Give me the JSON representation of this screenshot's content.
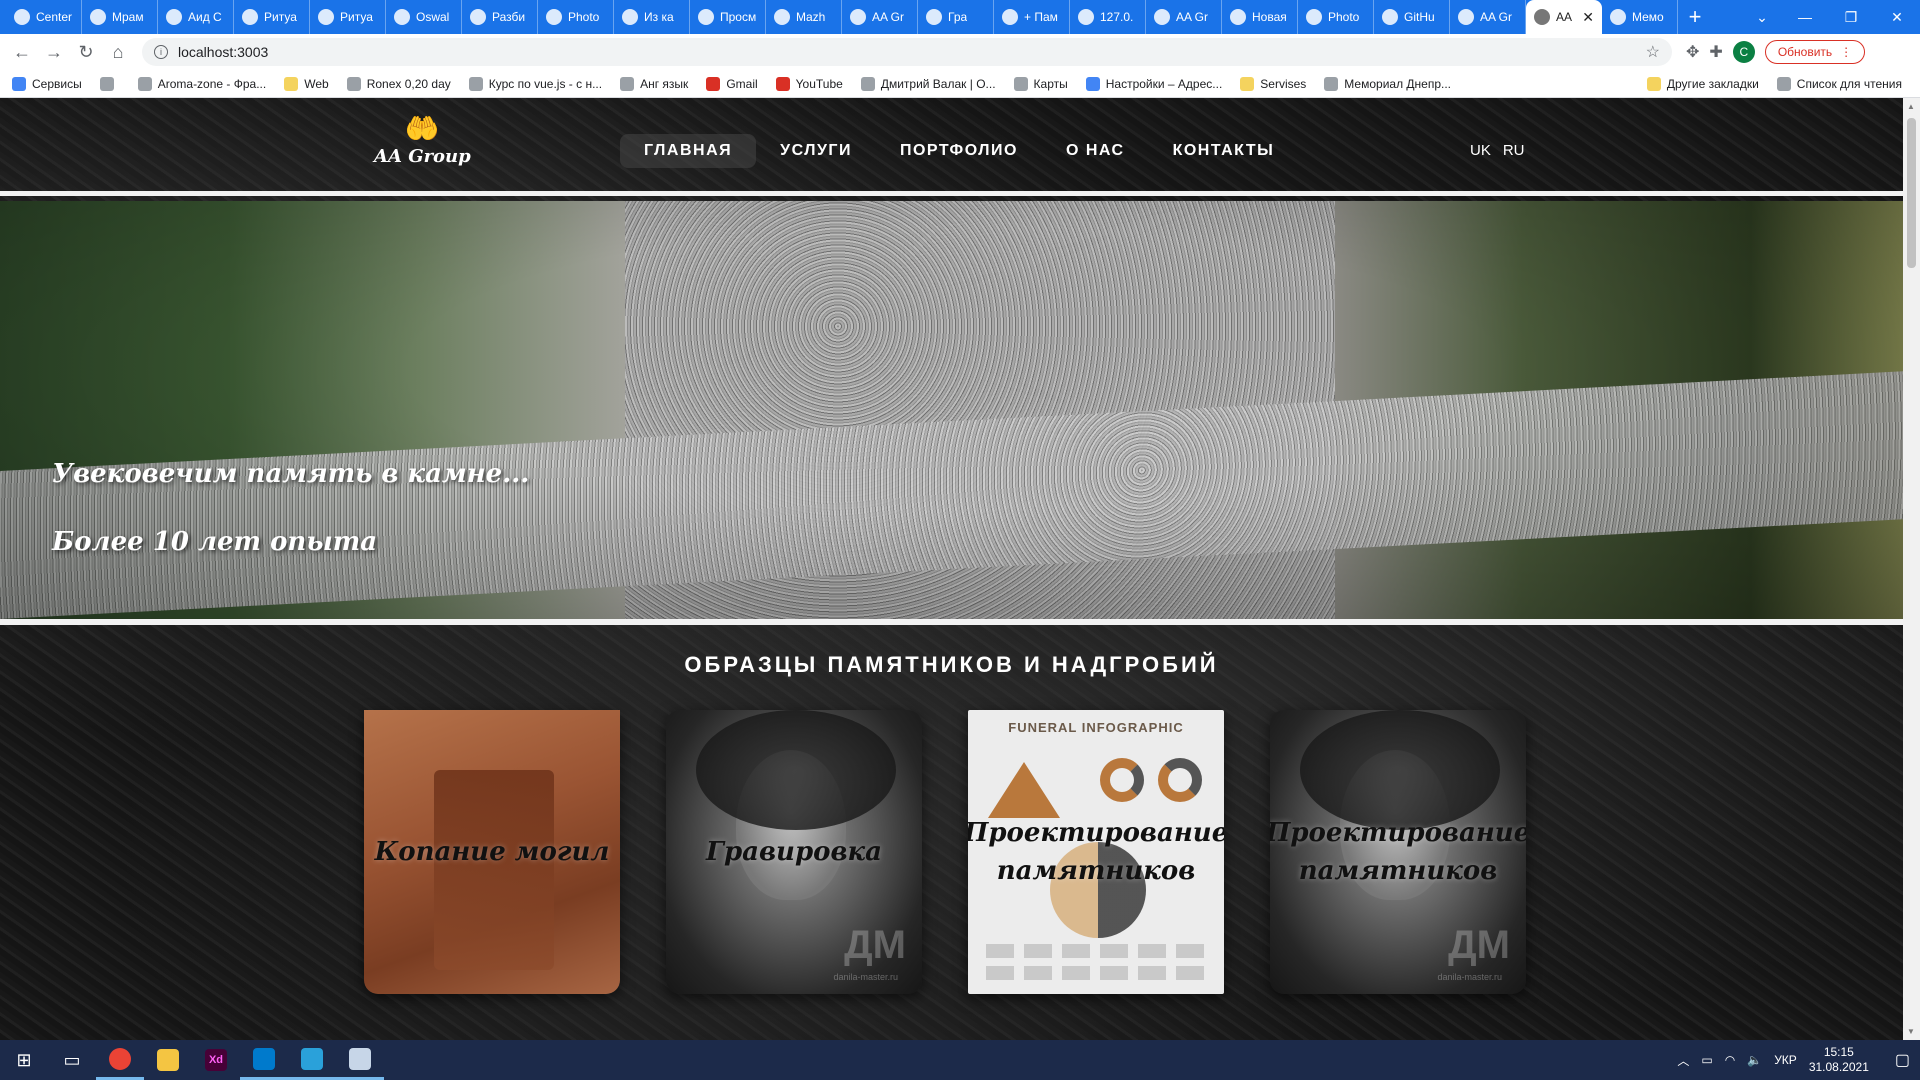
{
  "browser": {
    "tabs": [
      {
        "title": "Center"
      },
      {
        "title": "Мрам"
      },
      {
        "title": "Аид С"
      },
      {
        "title": "Ритуа"
      },
      {
        "title": "Ритуа"
      },
      {
        "title": "Oswal"
      },
      {
        "title": "Разби"
      },
      {
        "title": "Photo"
      },
      {
        "title": "Из ка"
      },
      {
        "title": "Просм"
      },
      {
        "title": "Mazh"
      },
      {
        "title": "AA Gr"
      },
      {
        "title": "Гра"
      },
      {
        "title": "+ Пам"
      },
      {
        "title": "127.0."
      },
      {
        "title": "AA Gr"
      },
      {
        "title": "Новая"
      },
      {
        "title": "Photo"
      },
      {
        "title": "GitHu"
      },
      {
        "title": "AA Gr"
      },
      {
        "title": "AA",
        "active": true
      },
      {
        "title": "Мемо"
      }
    ],
    "new_tab_label": "+",
    "url": "localhost:3003",
    "update_label": "Обновить",
    "profile_initial": "С",
    "bookmarks": [
      {
        "label": "Сервисы",
        "icon": "grid"
      },
      {
        "label": "",
        "icon": "globe"
      },
      {
        "label": "Aroma-zone - Фра...",
        "icon": "site"
      },
      {
        "label": "Web",
        "icon": "folder"
      },
      {
        "label": "Ronex 0,20 day",
        "icon": "site"
      },
      {
        "label": "Курс по vue.js - с н...",
        "icon": "site"
      },
      {
        "label": "Анг язык",
        "icon": "site"
      },
      {
        "label": "Gmail",
        "icon": "red"
      },
      {
        "label": "YouTube",
        "icon": "red"
      },
      {
        "label": "Дмитрий Валак | О...",
        "icon": "site"
      },
      {
        "label": "Карты",
        "icon": "site"
      },
      {
        "label": "Настройки – Адрес...",
        "icon": "grid"
      },
      {
        "label": "Servises",
        "icon": "folder"
      },
      {
        "label": "Мемориал Днепр...",
        "icon": "site"
      }
    ],
    "bookmarks_right": [
      {
        "label": "Другие закладки",
        "icon": "folder"
      },
      {
        "label": "Список для чтения",
        "icon": "site"
      }
    ]
  },
  "site": {
    "logo_text": "AA Group",
    "nav": [
      {
        "label": "ГЛАВНАЯ",
        "active": true
      },
      {
        "label": "УСЛУГИ"
      },
      {
        "label": "ПОРТФОЛИО"
      },
      {
        "label": "О НАС"
      },
      {
        "label": "КОНТАКТЫ"
      }
    ],
    "languages": [
      "UK",
      "RU"
    ],
    "hero": {
      "line1": "Увековечим память в камне...",
      "line2": "Более 10 лет опыта"
    },
    "section_title": "ОБРАЗЦЫ ПАМЯТНИКОВ И НАДГРОБИЙ",
    "cards": [
      {
        "label": "Копание могил",
        "style": "dig"
      },
      {
        "label": "Гравировка",
        "style": "portrait",
        "watermark": "ДМ",
        "watermark_sub": "danila-master.ru"
      },
      {
        "label": "Проектирование памятников",
        "style": "info",
        "header": "FUNERAL INFOGRAPHIC"
      },
      {
        "label": "Проектирование памятников",
        "style": "portrait",
        "watermark": "ДМ",
        "watermark_sub": "danila-master.ru"
      }
    ]
  },
  "taskbar": {
    "apps": [
      {
        "name": "chrome",
        "color": "#ea4335",
        "running": true
      },
      {
        "name": "file-explorer",
        "color": "#f4c542",
        "running": false
      },
      {
        "name": "adobe-xd",
        "color": "#470137",
        "label": "Xd",
        "running": false
      },
      {
        "name": "vscode",
        "color": "#007acc",
        "running": true
      },
      {
        "name": "telegram",
        "color": "#2aa1da",
        "running": true
      },
      {
        "name": "paint",
        "color": "#c7d6e8",
        "running": true
      }
    ],
    "lang": "УКР",
    "time": "15:15",
    "date": "31.08.2021"
  }
}
